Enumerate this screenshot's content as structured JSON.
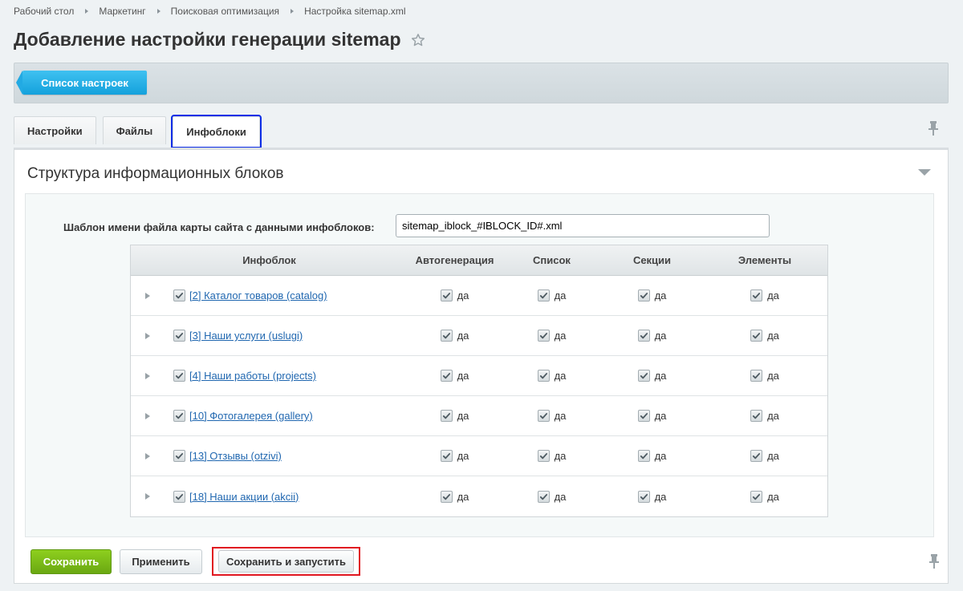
{
  "breadcrumbs": [
    "Рабочий стол",
    "Маркетинг",
    "Поисковая оптимизация",
    "Настройка sitemap.xml"
  ],
  "page_title": "Добавление настройки генерации sitemap",
  "toolbar": {
    "back_label": "Список настроек"
  },
  "tabs": [
    {
      "label": "Настройки",
      "active": false
    },
    {
      "label": "Файлы",
      "active": false
    },
    {
      "label": "Инфоблоки",
      "active": true
    }
  ],
  "section": {
    "title": "Структура информационных блоков",
    "field_label": "Шаблон имени файла карты сайта с данными инфоблоков:",
    "field_value": "sitemap_iblock_#IBLOCK_ID#.xml"
  },
  "table": {
    "headers": [
      "Инфоблок",
      "Автогенерация",
      "Список",
      "Секции",
      "Элементы"
    ],
    "yes_label": "да",
    "rows": [
      {
        "name": "[2] Каталог товаров (catalog)"
      },
      {
        "name": "[3] Наши услуги (uslugi)"
      },
      {
        "name": "[4] Наши работы (projects)"
      },
      {
        "name": "[10] Фотогалерея (gallery)"
      },
      {
        "name": "[13] Отзывы (otzivi)"
      },
      {
        "name": "[18] Наши акции (akcii)"
      }
    ]
  },
  "footer": {
    "save_label": "Сохранить",
    "apply_label": "Применить",
    "save_run_label": "Сохранить и запустить"
  },
  "colors": {
    "accent_blue": "#14a1dc",
    "save_green": "#7bbd18",
    "link": "#2067b0",
    "highlight_blue": "#0e2ee6",
    "highlight_red": "#e01620"
  }
}
